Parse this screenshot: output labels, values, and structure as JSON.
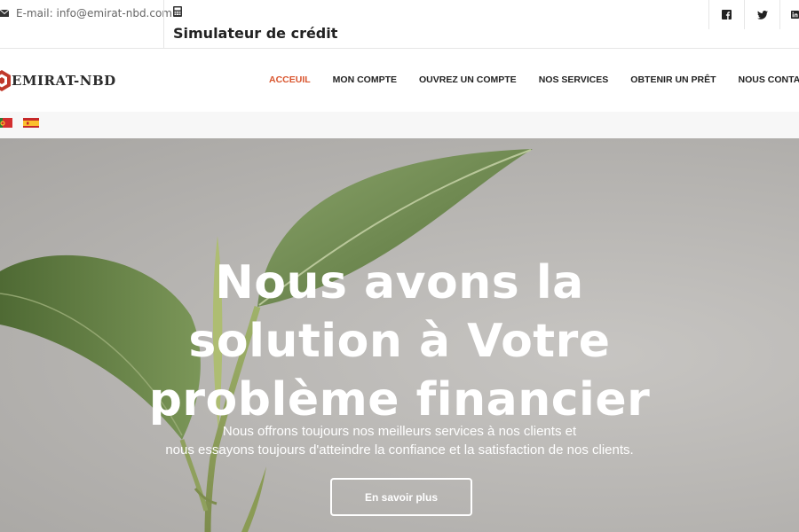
{
  "topbar": {
    "email": "E-mail: info@emirat-nbd.com",
    "simulator": "Simulateur de crédit",
    "socials": [
      "facebook-icon",
      "twitter-icon",
      "linkedin-icon"
    ]
  },
  "logo": {
    "text": "EMIRAT-NBD"
  },
  "nav": {
    "items": [
      {
        "label": "ACCEUIL",
        "active": true
      },
      {
        "label": "MON COMPTE"
      },
      {
        "label": "OUVREZ UN COMPTE"
      },
      {
        "label": "NOS SERVICES"
      },
      {
        "label": "OBTENIR UN PRÊT"
      },
      {
        "label": "NOUS CONTACTER"
      }
    ]
  },
  "languages": [
    "pt-flag-icon",
    "es-flag-icon"
  ],
  "hero": {
    "title_lines": [
      "Nous avons la",
      "solution à Votre",
      "problème financier"
    ],
    "subtitle_lines": [
      "Nous offrons toujours nos meilleurs services à nos clients et",
      "nous essayons toujours d'atteindre la confiance et la satisfaction de nos clients."
    ],
    "button": "En savoir plus"
  },
  "colors": {
    "accent": "#d9552e",
    "leaf": "#6f8a4e"
  }
}
